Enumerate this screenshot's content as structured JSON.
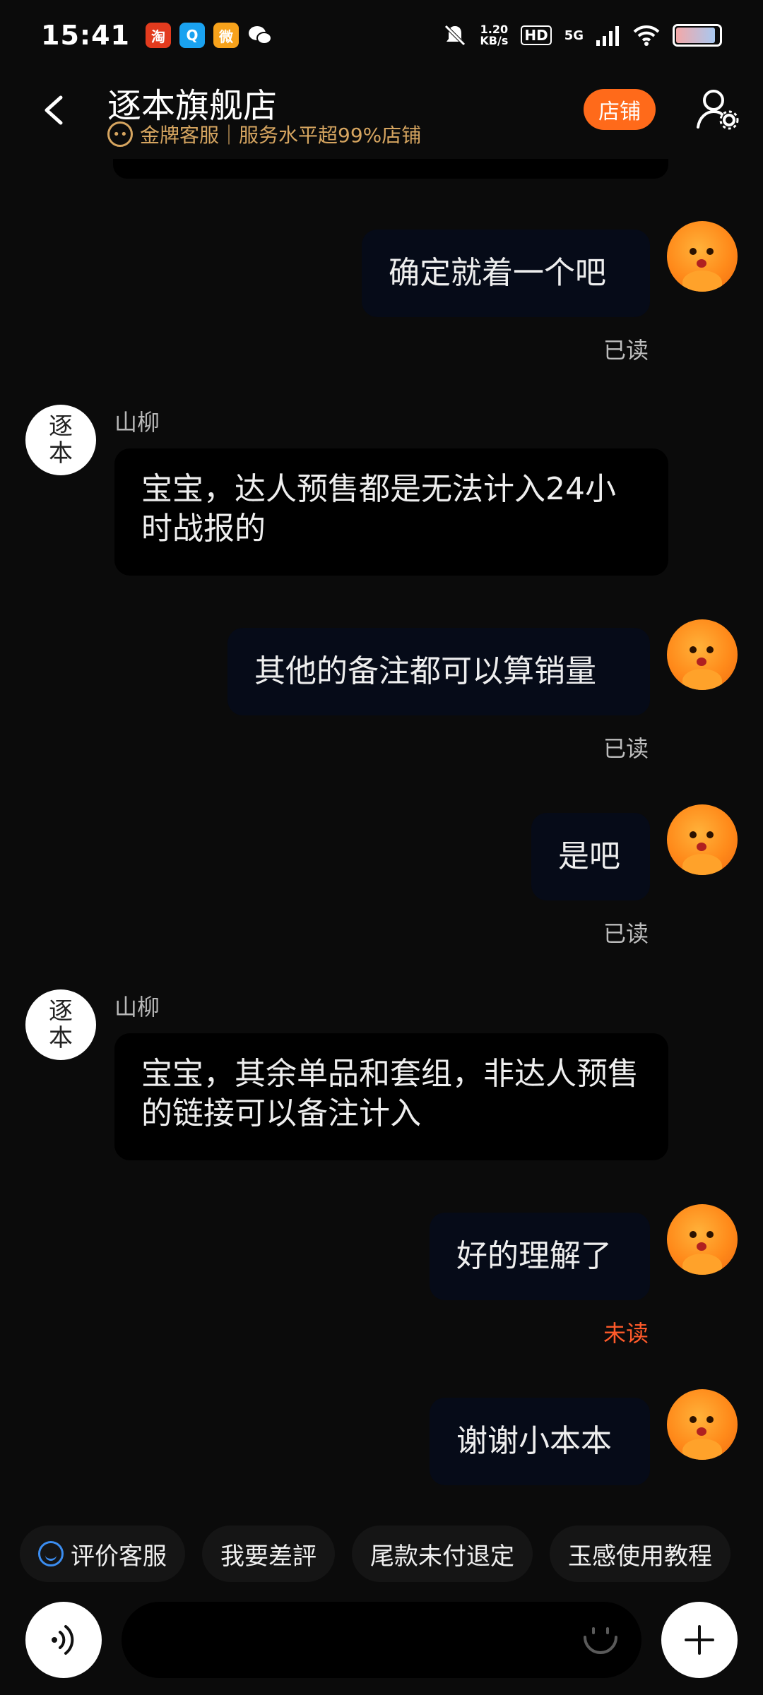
{
  "status_bar": {
    "time": "15:41",
    "net_speed_value": "1.20",
    "net_speed_unit": "KB/s",
    "hd_label": "HD",
    "network": "5G",
    "app_icons": [
      "taobao-icon",
      "qq-browser-icon",
      "weibo-icon",
      "wechat-icon"
    ]
  },
  "header": {
    "title": "逐本旗舰店",
    "subtitle": "金牌客服｜服务水平超99%店铺",
    "store_button": "店铺"
  },
  "messages": [
    {
      "side": "right",
      "text": "确定就着一个吧",
      "status": "已读"
    },
    {
      "side": "left",
      "sender": "山柳",
      "avatar_text": [
        "逐",
        "本"
      ],
      "text": "宝宝，达人预售都是无法计入24小时战报的"
    },
    {
      "side": "right",
      "text": "其他的备注都可以算销量",
      "status": "已读"
    },
    {
      "side": "right",
      "text": "是吧",
      "status": "已读"
    },
    {
      "side": "left",
      "sender": "山柳",
      "avatar_text": [
        "逐",
        "本"
      ],
      "text": "宝宝，其余单品和套组，非达人预售的链接可以备注计入"
    },
    {
      "side": "right",
      "text": "好的理解了",
      "status": "未读"
    },
    {
      "side": "right",
      "text": "谢谢小本本",
      "status": ""
    }
  ],
  "quick_replies": [
    "评价客服",
    "我要差評",
    "尾款未付退定",
    "玉感使用教程"
  ],
  "input": {
    "placeholder": ""
  },
  "colors": {
    "accent": "#ff6a1a",
    "gold": "#d6a560",
    "unread": "#ff5a2a",
    "background": "#0b0b0b"
  }
}
